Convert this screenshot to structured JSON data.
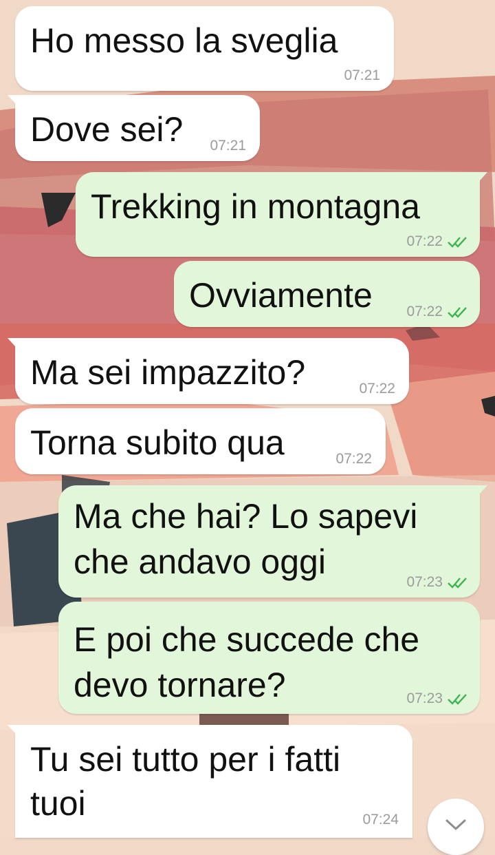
{
  "colors": {
    "incoming_bubble": "#ffffff",
    "outgoing_bubble": "#e2f6da",
    "timestamp": "#9b9b9b",
    "read_ticks": "#4fc3f7",
    "wallpaper_base": "#f1d9c8"
  },
  "messages": [
    {
      "direction": "incoming",
      "text": "Ho messo la sveglia",
      "time": "07:21"
    },
    {
      "direction": "incoming",
      "text": "Dove sei?",
      "time": "07:21"
    },
    {
      "direction": "outgoing",
      "text": "Trekking in montagna",
      "time": "07:22",
      "status": "read"
    },
    {
      "direction": "outgoing",
      "text": "Ovviamente",
      "time": "07:22",
      "status": "read"
    },
    {
      "direction": "incoming",
      "text": "Ma sei impazzito?",
      "time": "07:22"
    },
    {
      "direction": "incoming",
      "text": "Torna subito qua",
      "time": "07:22"
    },
    {
      "direction": "outgoing",
      "text": "Ma che hai? Lo sapevi\nche andavo oggi",
      "time": "07:23",
      "status": "read"
    },
    {
      "direction": "outgoing",
      "text": "E poi che succede che\ndevo tornare?",
      "time": "07:23",
      "status": "read"
    },
    {
      "direction": "incoming",
      "text": "Tu sei tutto per i fatti\ntuoi",
      "time": "07:24"
    }
  ],
  "scroll_button": {
    "icon": "chevron-down-icon"
  }
}
